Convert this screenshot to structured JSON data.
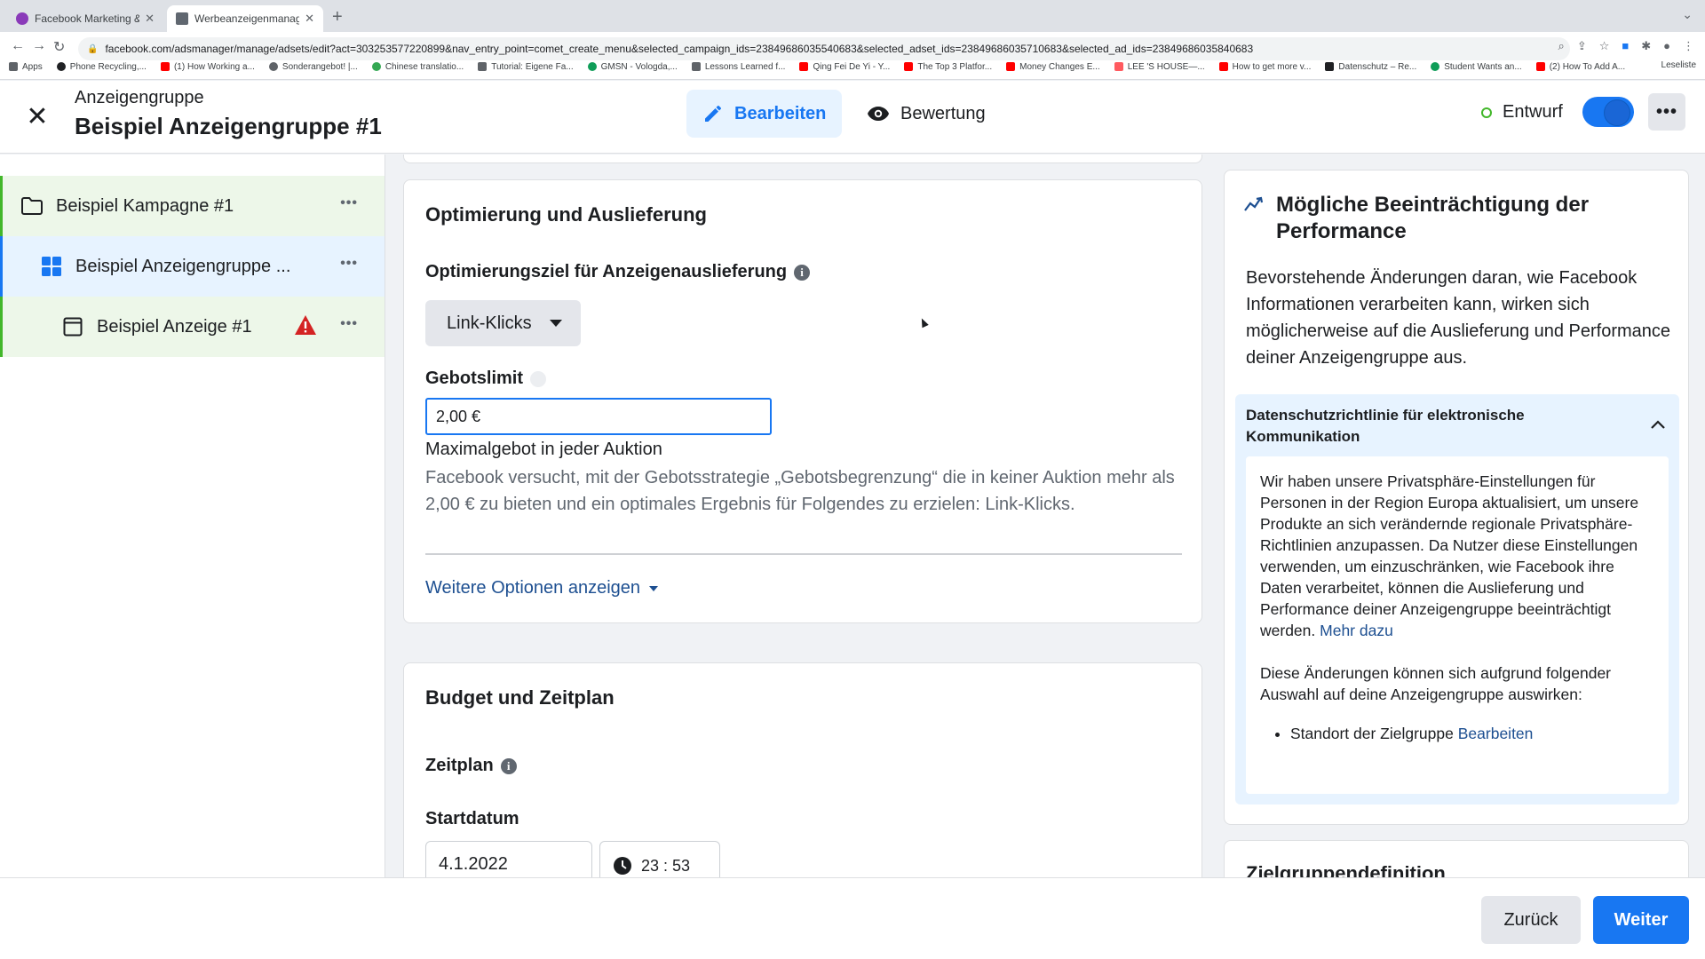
{
  "browser": {
    "tabs": [
      {
        "title": "Facebook Marketing & Werbea...",
        "favicon_color": "#8a3ab9"
      },
      {
        "title": "Werbeanzeigenmanager - Wer...",
        "favicon_color": "#606770"
      }
    ],
    "url": "facebook.com/adsmanager/manage/adsets/edit?act=303253577220899&nav_entry_point=comet_create_menu&selected_campaign_ids=23849686035540683&selected_adset_ids=23849686035710683&selected_ad_ids=23849686035840683",
    "bookmarks": [
      {
        "label": "Apps",
        "color": "#5f6368"
      },
      {
        "label": "Phone Recycling,...",
        "color": "#202124"
      },
      {
        "label": "(1) How Working a...",
        "color": "#ff0000"
      },
      {
        "label": "Sonderangebot! |...",
        "color": "#5f6368"
      },
      {
        "label": "Chinese translatio...",
        "color": "#34a853"
      },
      {
        "label": "Tutorial: Eigene Fa...",
        "color": "#5f6368"
      },
      {
        "label": "GMSN - Vologda,...",
        "color": "#0f9d58"
      },
      {
        "label": "Lessons Learned f...",
        "color": "#5f6368"
      },
      {
        "label": "Qing Fei De Yi - Y...",
        "color": "#ff0000"
      },
      {
        "label": "The Top 3 Platfor...",
        "color": "#ff0000"
      },
      {
        "label": "Money Changes E...",
        "color": "#ff0000"
      },
      {
        "label": "LEE 'S HOUSE—...",
        "color": "#ff5a5f"
      },
      {
        "label": "How to get more v...",
        "color": "#ff0000"
      },
      {
        "label": "Datenschutz – Re...",
        "color": "#202124"
      },
      {
        "label": "Student Wants an...",
        "color": "#0f9d58"
      },
      {
        "label": "(2) How To Add A...",
        "color": "#ff0000"
      }
    ],
    "reading_list": "Leseliste"
  },
  "header": {
    "subtitle": "Anzeigengruppe",
    "title": "Beispiel Anzeigengruppe #1",
    "tab_edit": "Bearbeiten",
    "tab_review": "Bewertung",
    "status": "Entwurf"
  },
  "sidebar": {
    "campaign": "Beispiel Kampagne #1",
    "adset": "Beispiel Anzeigengruppe ...",
    "ad": "Beispiel Anzeige #1"
  },
  "optimization": {
    "heading": "Optimierung und Auslieferung",
    "goal_label": "Optimierungsziel für Anzeigenauslieferung",
    "goal_value": "Link-Klicks",
    "bid_label": "Gebotslimit",
    "bid_value": "2,00 €",
    "bid_caption": "Maximalgebot in jeder Auktion",
    "bid_description": "Facebook versucht, mit der Gebotsstrategie „Gebotsbegrenzung“ die in keiner Auktion mehr als 2,00 € zu bieten und ein optimales Ergebnis für Folgendes zu erzielen: Link-Klicks.",
    "more_options": "Weitere Optionen anzeigen"
  },
  "budget": {
    "heading": "Budget und Zeitplan",
    "schedule_label": "Zeitplan",
    "start_label": "Startdatum",
    "start_date": "4.1.2022",
    "start_time": "23 : 53"
  },
  "right_panel": {
    "title": "Mögliche Beeinträchtigung der Performance",
    "body": "Bevorstehende Änderungen daran, wie Facebook Informationen verarbeiten kann, wirken sich möglicherweise auf die Auslieferung und Performance deiner Anzeigengruppe aus.",
    "accordion_title": "Datenschutzrichtlinie für elektronische Kommunikation",
    "accordion_text": "Wir haben unsere Privatsphäre-Einstellungen für Personen in der Region Europa aktualisiert, um unsere Produkte an sich verändernde regionale Privatsphäre-Richtlinien anzupassen. Da Nutzer diese Einstellungen verwenden, um einzuschränken, wie Facebook ihre Daten verarbeitet, können die Auslieferung und Performance deiner Anzeigengruppe beeinträchtigt werden.",
    "learn_more": "Mehr dazu",
    "accordion_text2": "Diese Änderungen können sich aufgrund folgender Auswahl auf deine Anzeigengruppe auswirken:",
    "bullet": "Standort der Zielgruppe",
    "bullet_link": "Bearbeiten",
    "next_section": "Zielgruppendefinition"
  },
  "footer": {
    "back": "Zurück",
    "next": "Weiter"
  },
  "colors": {
    "accent": "#1877f2",
    "draft_green": "#42b72a",
    "warning_red": "#d42323"
  }
}
